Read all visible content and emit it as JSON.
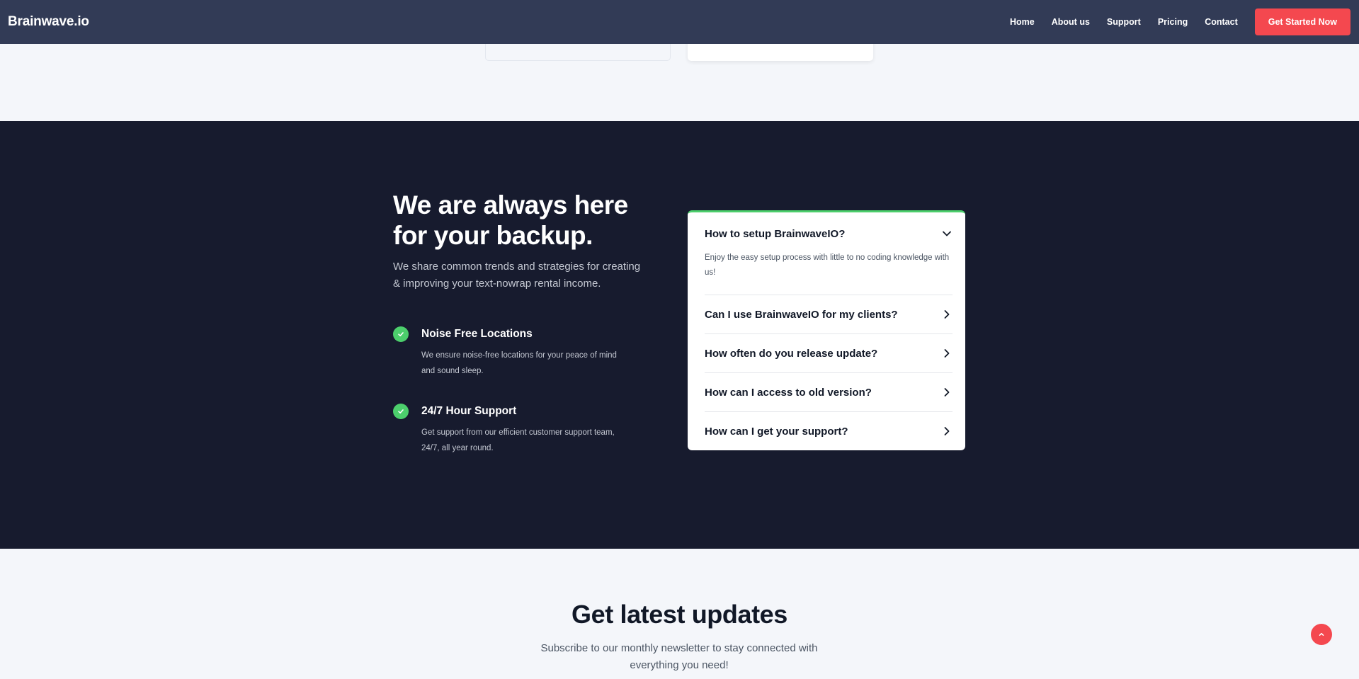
{
  "header": {
    "brand": "Brainwave.io",
    "nav": [
      "Home",
      "About us",
      "Support",
      "Pricing",
      "Contact"
    ],
    "cta": "Get Started Now"
  },
  "hero": {
    "title": "We are always here for your backup.",
    "subtitle": "We share common trends and strategies for creating & improving your text-nowrap rental income."
  },
  "features": [
    {
      "title": "Noise Free Locations",
      "description": "We ensure noise-free locations for your peace of mind and sound sleep.",
      "icon": "check-icon"
    },
    {
      "title": "24/7 Hour Support",
      "description": "Get support from our efficient customer support team, 24/7, all year round.",
      "icon": "check-icon"
    }
  ],
  "faq": {
    "items": [
      {
        "question": "How to setup BrainwaveIO?",
        "answer": "Enjoy the easy setup process with little to no coding knowledge with us!",
        "expanded": true
      },
      {
        "question": "Can I use BrainwaveIO for my clients?",
        "expanded": false
      },
      {
        "question": "How often do you release update?",
        "expanded": false
      },
      {
        "question": "How can I access to old version?",
        "expanded": false
      },
      {
        "question": "How can I get your support?",
        "expanded": false
      }
    ]
  },
  "newsletter": {
    "title": "Get latest updates",
    "subtitle": "Subscribe to our monthly newsletter to stay connected with everything you need!"
  },
  "colors": {
    "header_bg": "#323b56",
    "dark_bg": "#171b2e",
    "accent_red": "#f4484f",
    "accent_green": "#4ccf6c"
  }
}
